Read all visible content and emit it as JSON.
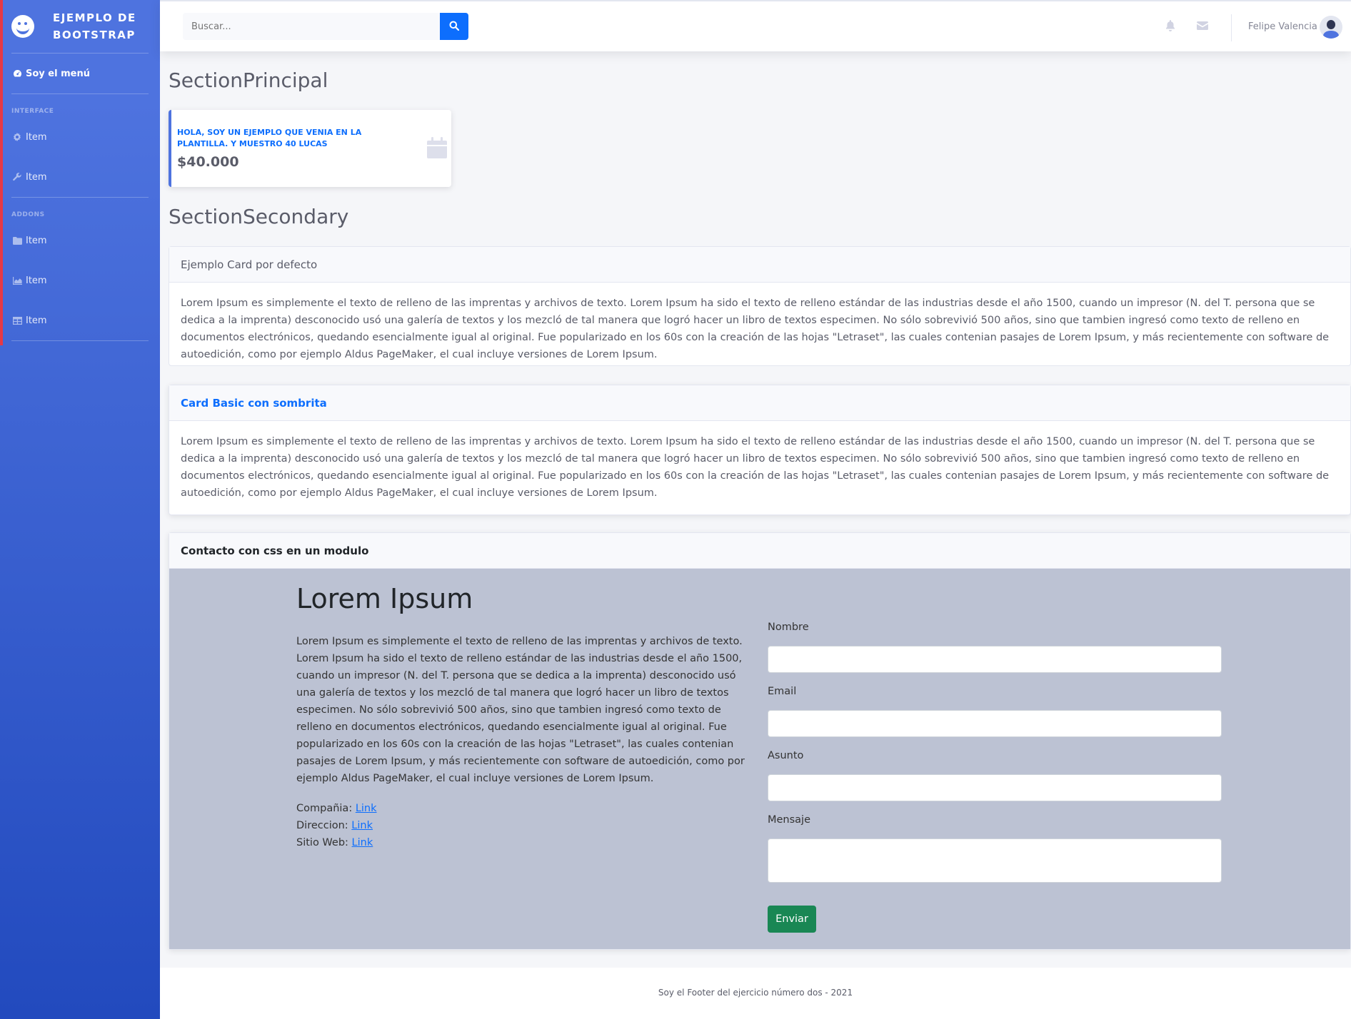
{
  "sidebar": {
    "brand": "EJEMPLO DE BOOTSTRAP",
    "dashboard_label": "Soy el menú",
    "heading_interface": "INTERFACE",
    "heading_addons": "ADDONS",
    "items": [
      {
        "label": "Item",
        "icon": "cog-icon"
      },
      {
        "label": "Item",
        "icon": "wrench-icon"
      },
      {
        "label": "Item",
        "icon": "folder-icon"
      },
      {
        "label": "Item",
        "icon": "chart-area-icon"
      },
      {
        "label": "Item",
        "icon": "table-icon"
      }
    ],
    "gradient_from": "#4e73df",
    "gradient_to": "#224abe",
    "accent_line": "#e63946"
  },
  "topbar": {
    "search_placeholder": "Buscar...",
    "user_name": "Felipe Valencia"
  },
  "main": {
    "section_principal": "SectionPrincipal",
    "stat_card": {
      "label": "HOLA, SOY UN EJEMPLO QUE VENIA EN LA PLANTILLA. Y MUESTRO 40 LUCAS",
      "value": "$40.000"
    },
    "section_secondary": "SectionSecondary",
    "card_default": {
      "title": "Ejemplo Card por defecto",
      "body": "Lorem Ipsum es simplemente el texto de relleno de las imprentas y archivos de texto. Lorem Ipsum ha sido el texto de relleno estándar de las industrias desde el año 1500, cuando un impresor (N. del T. persona que se dedica a la imprenta) desconocido usó una galería de textos y los mezcló de tal manera que logró hacer un libro de textos especimen. No sólo sobrevivió 500 años, sino que tambien ingresó como texto de relleno en documentos electrónicos, quedando esencialmente igual al original. Fue popularizado en los 60s con la creación de las hojas \"Letraset\", las cuales contenian pasajes de Lorem Ipsum, y más recientemente con software de autoedición, como por ejemplo Aldus PageMaker, el cual incluye versiones de Lorem Ipsum."
    },
    "card_shadow": {
      "title": "Card Basic con sombrita",
      "body": "Lorem Ipsum es simplemente el texto de relleno de las imprentas y archivos de texto. Lorem Ipsum ha sido el texto de relleno estándar de las industrias desde el año 1500, cuando un impresor (N. del T. persona que se dedica a la imprenta) desconocido usó una galería de textos y los mezcló de tal manera que logró hacer un libro de textos especimen. No sólo sobrevivió 500 años, sino que tambien ingresó como texto de relleno en documentos electrónicos, quedando esencialmente igual al original. Fue popularizado en los 60s con la creación de las hojas \"Letraset\", las cuales contenian pasajes de Lorem Ipsum, y más recientemente con software de autoedición, como por ejemplo Aldus PageMaker, el cual incluye versiones de Lorem Ipsum."
    },
    "contact": {
      "card_title": "Contacto con css en un modulo",
      "heading": "Lorem Ipsum",
      "text": "Lorem Ipsum es simplemente el texto de relleno de las imprentas y archivos de texto. Lorem Ipsum ha sido el texto de relleno estándar de las industrias desde el año 1500, cuando un impresor (N. del T. persona que se dedica a la imprenta) desconocido usó una galería de textos y los mezcló de tal manera que logró hacer un libro de textos especimen. No sólo sobrevivió 500 años, sino que tambien ingresó como texto de relleno en documentos electrónicos, quedando esencialmente igual al original. Fue popularizado en los 60s con la creación de las hojas \"Letraset\", las cuales contenian pasajes de Lorem Ipsum, y más recientemente con software de autoedición, como por ejemplo Aldus PageMaker, el cual incluye versiones de Lorem Ipsum.",
      "company_label": "Compañia:",
      "address_label": "Direccion:",
      "website_label": "Sitio Web:",
      "link_text": "Link",
      "form": {
        "name_label": "Nombre",
        "email_label": "Email",
        "subject_label": "Asunto",
        "message_label": "Mensaje",
        "submit_label": "Enviar"
      },
      "background": "#bcc2d3"
    }
  },
  "footer": {
    "text": "Soy el Footer del ejercicio número dos - 2021"
  }
}
